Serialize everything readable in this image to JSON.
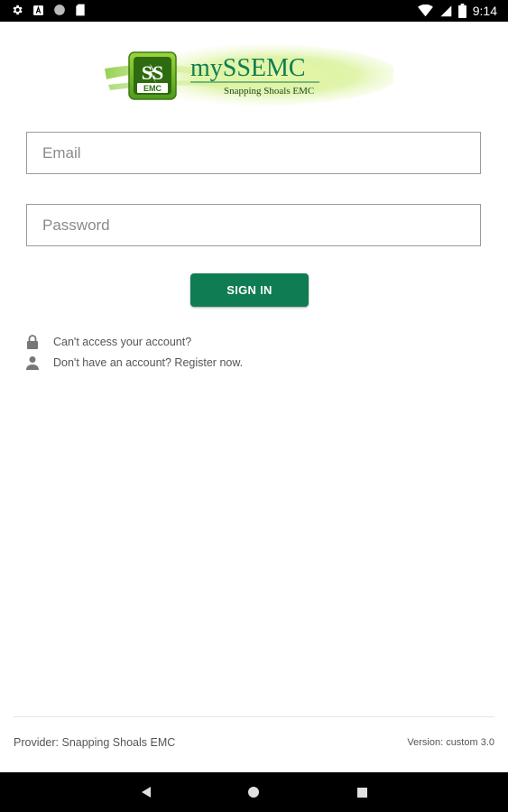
{
  "status_bar": {
    "time": "9:14",
    "left_icons": [
      "settings-gear-icon",
      "notification-a-icon",
      "circle-icon",
      "sd-card-icon"
    ],
    "right_icons": [
      "wifi-icon",
      "cell-signal-icon",
      "battery-icon"
    ]
  },
  "logo": {
    "emblem_letters": "SS",
    "emblem_sub": "EMC",
    "brand_name": "mySSEMC",
    "tagline": "Snapping Shoals EMC",
    "accent_color": "#107c53",
    "glow_color": "#9bd63a"
  },
  "form": {
    "email_placeholder": "Email",
    "password_placeholder": "Password",
    "sign_in_label": "SIGN IN",
    "button_color": "#107c53"
  },
  "help_links": [
    {
      "icon": "lock-icon",
      "label": "Can't access your account?"
    },
    {
      "icon": "person-icon",
      "label": "Don't have an account? Register now."
    }
  ],
  "footer": {
    "provider": "Provider: Snapping Shoals EMC",
    "version": "Version: custom 3.0"
  },
  "nav_bar": {
    "buttons": [
      "back-icon",
      "home-icon",
      "recents-icon"
    ]
  }
}
